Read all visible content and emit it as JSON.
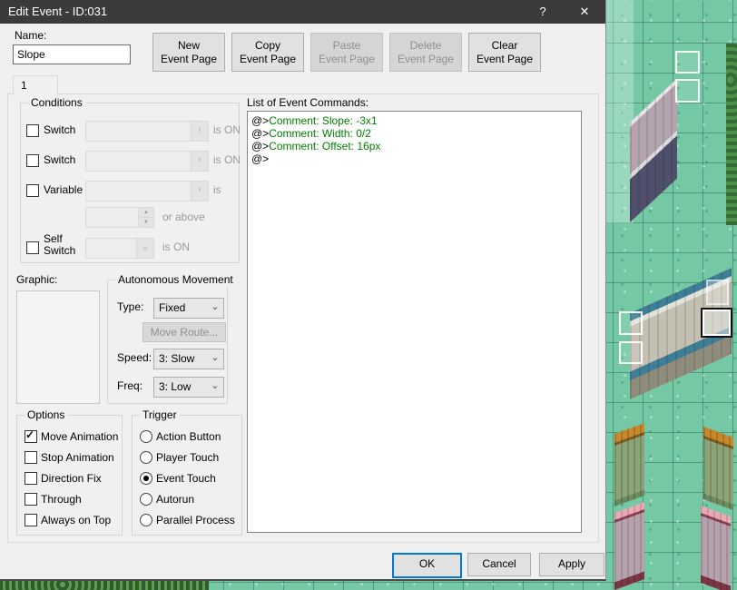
{
  "window": {
    "title": "Edit Event - ID:031"
  },
  "icons": {
    "help": "?",
    "close": "✕",
    "chevron_right": "›",
    "chevron_down": "⌄",
    "spinner_up": "▲",
    "spinner_down": "▼",
    "check": "✓"
  },
  "name_field": {
    "label": "Name:",
    "value": "Slope"
  },
  "page_buttons": [
    {
      "label": "New\nEvent Page",
      "enabled": true
    },
    {
      "label": "Copy\nEvent Page",
      "enabled": true
    },
    {
      "label": "Paste\nEvent Page",
      "enabled": false
    },
    {
      "label": "Delete\nEvent Page",
      "enabled": false
    },
    {
      "label": "Clear\nEvent Page",
      "enabled": true
    }
  ],
  "tab": {
    "label": "1"
  },
  "conditions": {
    "title": "Conditions",
    "switch1": {
      "label": "Switch",
      "suffix": "is ON",
      "enabled": false,
      "value": ""
    },
    "switch2": {
      "label": "Switch",
      "suffix": "is ON",
      "enabled": false,
      "value": ""
    },
    "variable": {
      "label": "Variable",
      "suffix": "is",
      "enabled": false,
      "value": ""
    },
    "value_row": {
      "suffix": "or above",
      "value": ""
    },
    "self_switch": {
      "label": "Self\nSwitch",
      "suffix": "is ON",
      "enabled": false,
      "value": ""
    }
  },
  "graphic": {
    "label": "Graphic:"
  },
  "movement": {
    "title": "Autonomous Movement",
    "type_label": "Type:",
    "type_value": "Fixed",
    "move_route_label": "Move Route...",
    "move_route_enabled": false,
    "speed_label": "Speed:",
    "speed_value": "3: Slow",
    "freq_label": "Freq:",
    "freq_value": "3: Low"
  },
  "options": {
    "title": "Options",
    "items": [
      {
        "label": "Move Animation",
        "checked": true
      },
      {
        "label": "Stop Animation",
        "checked": false
      },
      {
        "label": "Direction Fix",
        "checked": false
      },
      {
        "label": "Through",
        "checked": false
      },
      {
        "label": "Always on Top",
        "checked": false
      }
    ]
  },
  "trigger": {
    "title": "Trigger",
    "items": [
      {
        "label": "Action Button",
        "selected": false
      },
      {
        "label": "Player Touch",
        "selected": false
      },
      {
        "label": "Event Touch",
        "selected": true
      },
      {
        "label": "Autorun",
        "selected": false
      },
      {
        "label": "Parallel Process",
        "selected": false
      }
    ]
  },
  "commands": {
    "label": "List of Event Commands:",
    "lines": [
      {
        "prefix": "@>",
        "text": "Comment: Slope: -3x1"
      },
      {
        "prefix": "@>",
        "text": "Comment: Width: 0/2"
      },
      {
        "prefix": "@>",
        "text": "Comment: Offset: 16px"
      },
      {
        "prefix": "@>",
        "text": ""
      }
    ]
  },
  "footer": {
    "ok": "OK",
    "cancel": "Cancel",
    "apply": "Apply"
  },
  "colors": {
    "accent": "#0078d7",
    "comment_green": "#008000",
    "titlebar": "#3b3b3b",
    "grass": "#74c9a4"
  }
}
